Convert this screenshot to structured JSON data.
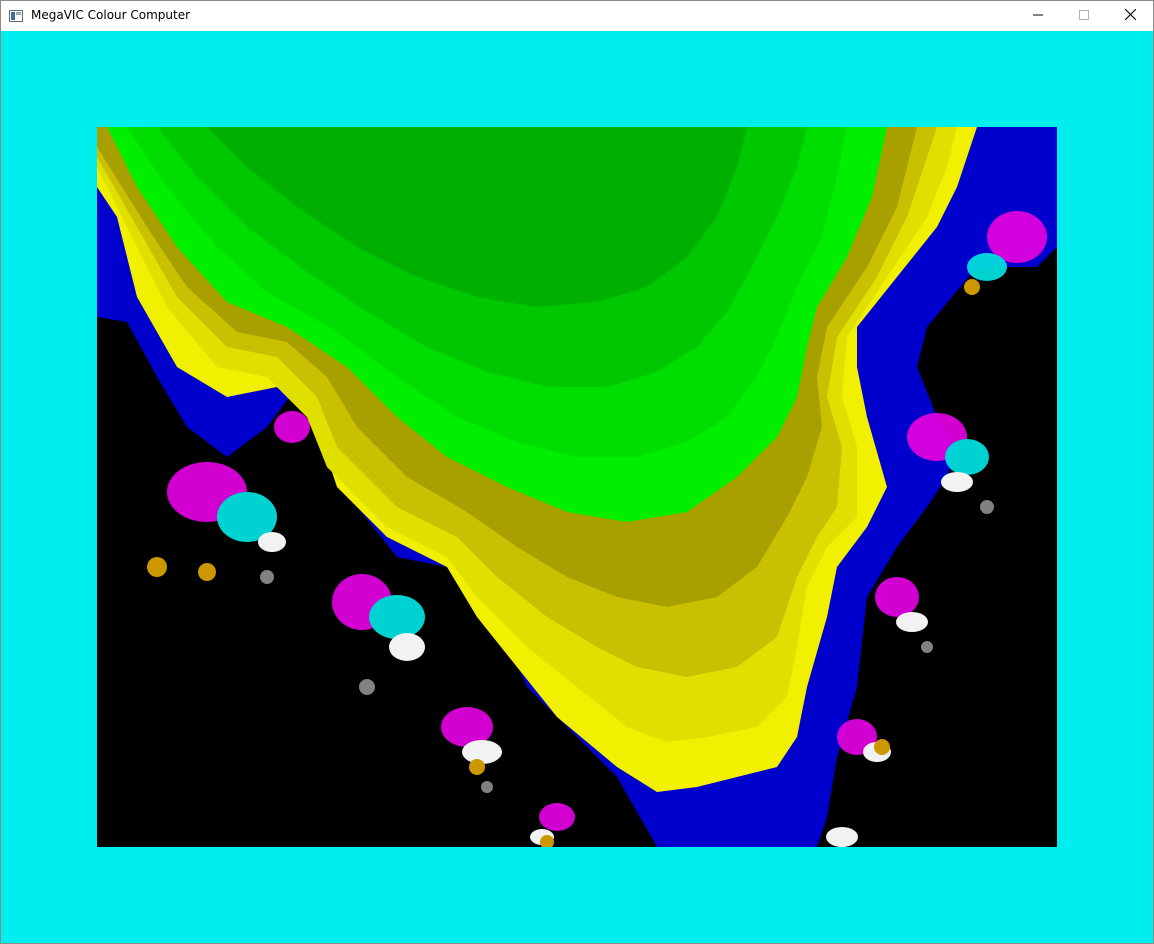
{
  "window": {
    "title": "MegaVIC Colour Computer",
    "icon": "app-window-icon",
    "controls": {
      "minimize_icon": "minimize-icon",
      "maximize_icon": "maximize-icon",
      "close_icon": "close-icon"
    }
  },
  "screen": {
    "border_color": "#00eeee",
    "background_color": "#000000",
    "content": "fractal-render",
    "palette": {
      "green_dark": "#00b000",
      "green": "#00dd00",
      "green_light": "#00ee00",
      "olive": "#a8a000",
      "olive_light": "#c8c000",
      "yellow": "#e0e000",
      "yellow_bright": "#f0f000",
      "blue_dark": "#0000c0",
      "blue": "#0000ee",
      "magenta": "#dd00dd",
      "cyan": "#00dddd",
      "white": "#ffffff",
      "gray": "#888888",
      "orange": "#d8a000",
      "black": "#000000"
    }
  }
}
